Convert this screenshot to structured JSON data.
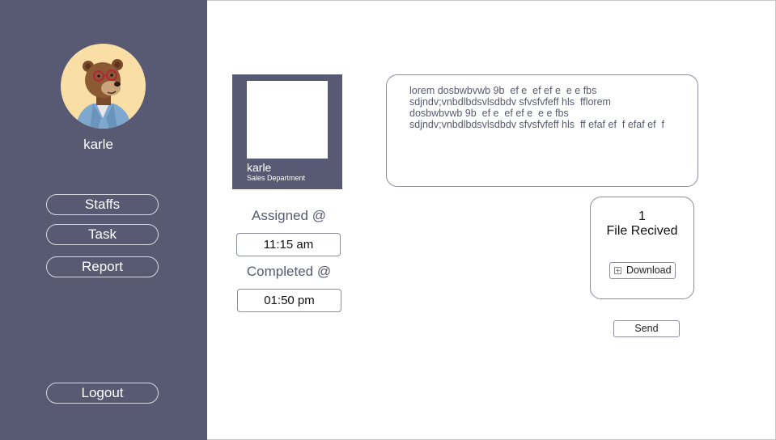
{
  "sidebar": {
    "user_name": "karle",
    "avatar_icon": "bear-avatar-icon",
    "nav": [
      {
        "label": "Staffs"
      },
      {
        "label": "Task"
      },
      {
        "label": "Report"
      }
    ],
    "logout_label": "Logout"
  },
  "card": {
    "name": "karle",
    "department": "Sales Department"
  },
  "times": {
    "assigned_label": "Assigned @",
    "assigned_value": "11:15 am",
    "completed_label": "Completed @",
    "completed_value": "01:50 pm"
  },
  "message": {
    "lines": [
      "lorem dosbwbvwb 9b  ef e  ef ef e  e e fbs",
      "sdjndv;vnbdlbdsvlsdbdv sfvsfvfeff hls  fflorem",
      "dosbwbvwb 9b  ef e  ef ef e  e e fbs",
      "sdjndv;vnbdlbdsvlsdbdv sfvsfvfeff hls  ff efaf ef  f efaf ef  f"
    ]
  },
  "file": {
    "count": "1",
    "label": "File Recived",
    "download_label": "Download",
    "download_icon": "plus-box-icon"
  },
  "send_label": "Send",
  "colors": {
    "sidebar_bg": "#575a72",
    "avatar_bg": "#f9dfa6",
    "border": "#8c8e9c"
  }
}
